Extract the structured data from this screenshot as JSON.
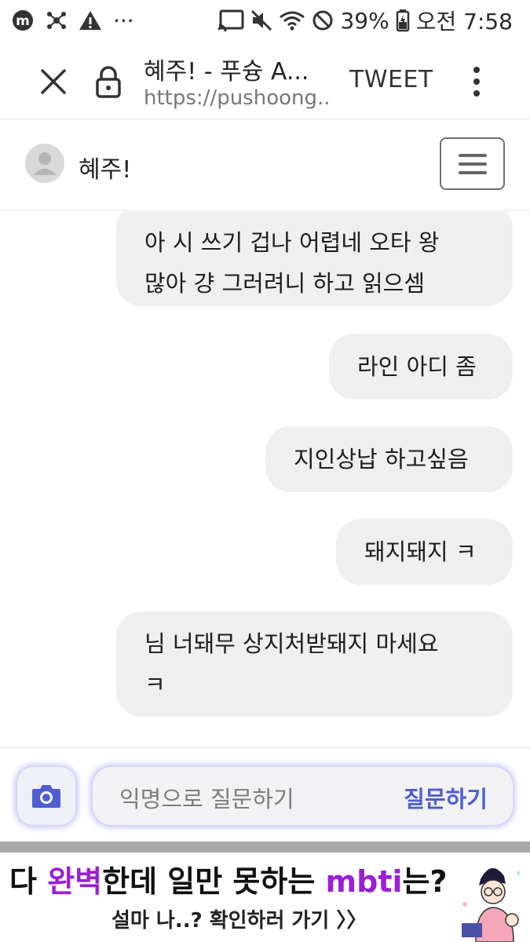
{
  "status_bar": {
    "icons": [
      "m-app-icon",
      "network-icon",
      "warning-icon",
      "more-dots"
    ],
    "right_icons": [
      "cast-icon",
      "mute-icon",
      "wifi-icon",
      "do-not-disturb-icon"
    ],
    "battery": "39%",
    "time": "오전 7:58"
  },
  "browser": {
    "title": "혜주! - 푸슝 A...",
    "url": "https://pushoong....",
    "tweet_label": "TWEET"
  },
  "profile": {
    "name": "혜주!"
  },
  "messages": [
    {
      "lines": [
        "아 시 쓰기 겁나 어렵네 오타 왕",
        "많아 걍 그러려니 하고 읽으셈"
      ]
    },
    {
      "lines": [
        "라인 아디 좀"
      ]
    },
    {
      "lines": [
        "지인상납 하고싶음"
      ]
    },
    {
      "lines": [
        "돼지돼지 ㅋ"
      ]
    },
    {
      "lines": [
        "님 너돼무 상지처받돼지 마세요",
        "ㅋ"
      ]
    }
  ],
  "input": {
    "placeholder": "익명으로 질문하기",
    "submit_label": "질문하기"
  },
  "ad": {
    "headline_1": "다 ",
    "headline_hl_1": "완벽",
    "headline_2": "한데 일만 못하는 ",
    "headline_hl_2": "mbti",
    "headline_3": "는?",
    "subline": "설마 나..? 확인하러 가기 〉〉"
  },
  "colors": {
    "accent": "#4e5ed1",
    "ad_highlight": "#9b1fd6",
    "bubble_bg": "#efefef"
  }
}
